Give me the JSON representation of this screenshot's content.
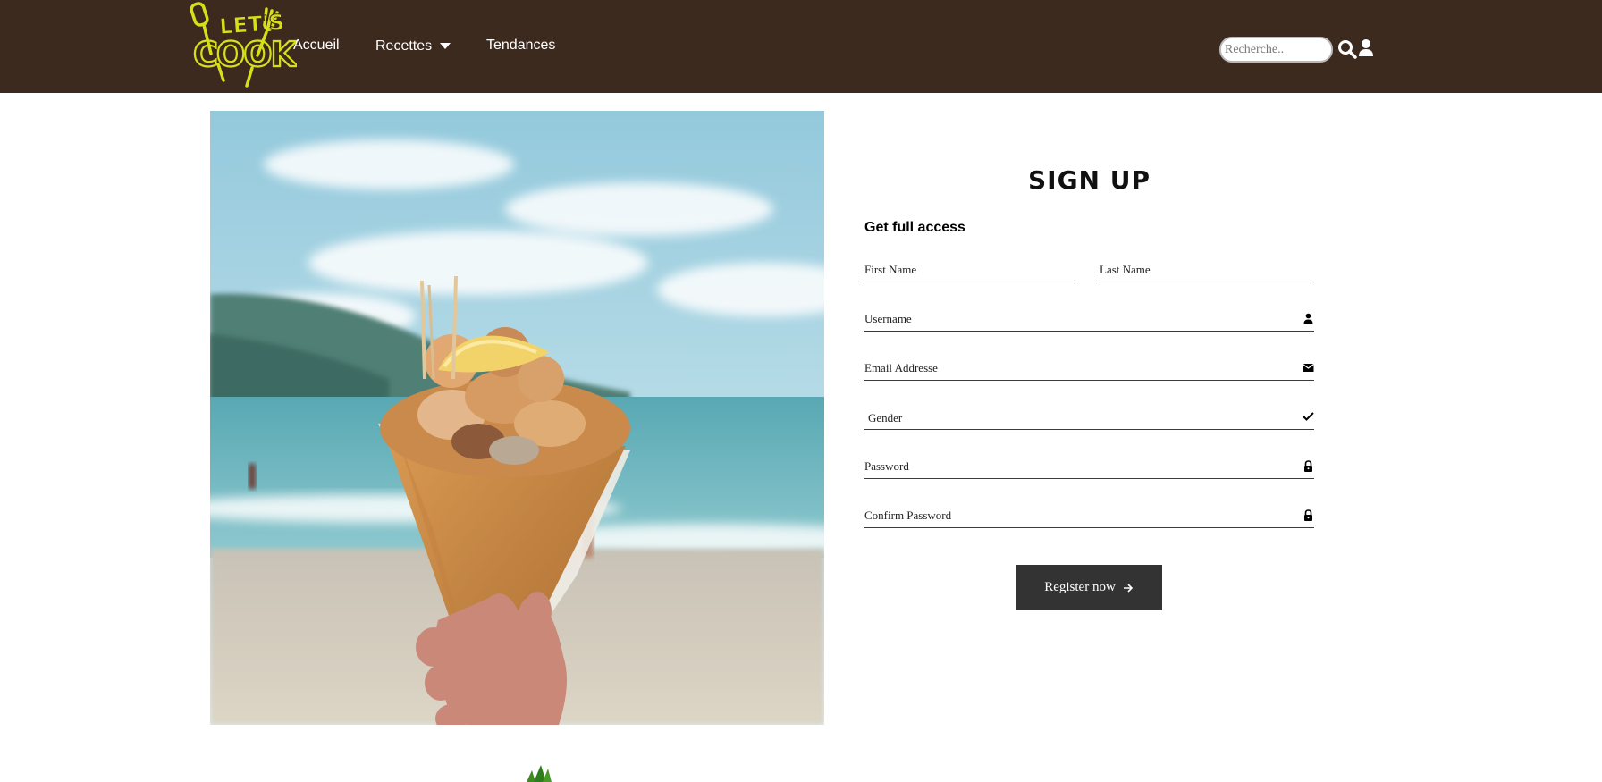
{
  "header": {
    "logo": {
      "text_line1": "LET'S",
      "text_line2": "COOK",
      "icon": "spatula-fork-logo",
      "color": "#d6e01a"
    },
    "background_color": "#3d2a1f",
    "nav": {
      "accueil": "Accueil",
      "recettes": "Recettes",
      "tendances": "Tendances"
    },
    "search": {
      "placeholder": "Recherche..",
      "icon": "search-icon"
    },
    "user_icon": "user-icon"
  },
  "hero": {
    "icon": "food-cone-photo"
  },
  "form": {
    "title": "SIGN UP",
    "subtitle": "Get full access",
    "fields": {
      "first_name": {
        "placeholder": "First Name",
        "value": ""
      },
      "last_name": {
        "placeholder": "Last Name",
        "value": ""
      },
      "username": {
        "placeholder": "Username",
        "value": "",
        "icon": "person-icon"
      },
      "email": {
        "placeholder": "Email Addresse",
        "value": "",
        "icon": "envelope-icon"
      },
      "gender": {
        "selected": "Gender",
        "icon": "check-icon"
      },
      "password": {
        "placeholder": "Password",
        "value": "",
        "icon": "lock-icon"
      },
      "confirm_password": {
        "placeholder": "Confirm Password",
        "value": "",
        "icon": "lock-icon"
      }
    },
    "submit": {
      "label": "Register now",
      "icon": "arrow-right-icon",
      "color": "#333333"
    }
  }
}
